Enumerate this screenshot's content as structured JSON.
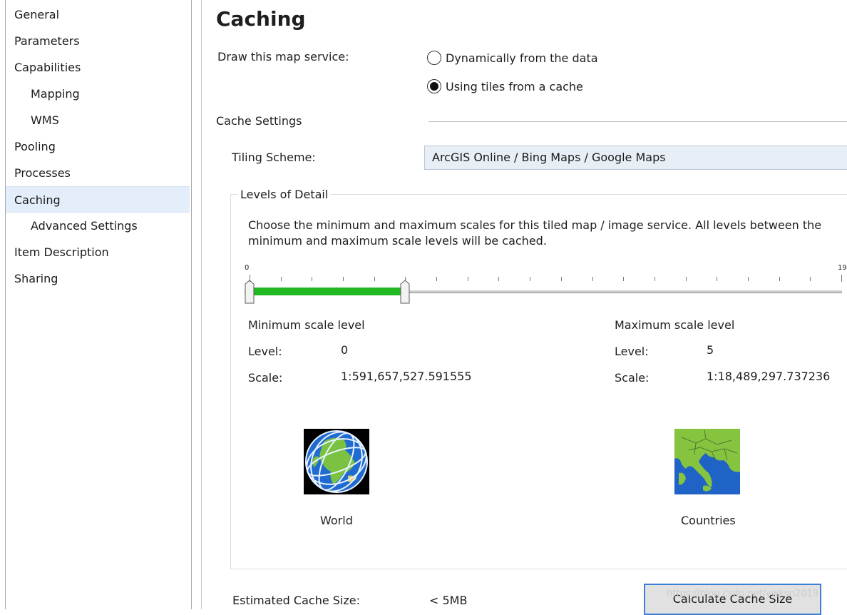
{
  "sidebar": {
    "items": [
      {
        "label": "General"
      },
      {
        "label": "Parameters"
      },
      {
        "label": "Capabilities"
      },
      {
        "label": "Mapping"
      },
      {
        "label": "WMS"
      },
      {
        "label": "Pooling"
      },
      {
        "label": "Processes"
      },
      {
        "label": "Caching"
      },
      {
        "label": "Advanced Settings"
      },
      {
        "label": "Item Description"
      },
      {
        "label": "Sharing"
      }
    ],
    "selected": "Caching"
  },
  "main": {
    "title": "Caching",
    "draw_label": "Draw this map service:",
    "draw_options": [
      {
        "label": "Dynamically from the data",
        "checked": false
      },
      {
        "label": "Using tiles from a cache",
        "checked": true
      }
    ],
    "cache_settings_label": "Cache Settings",
    "tiling_scheme_label": "Tiling Scheme:",
    "tiling_scheme_value": "ArcGIS Online / Bing Maps / Google Maps",
    "levels_of_detail": {
      "legend": "Levels of Detail",
      "description": "Choose the minimum and maximum scales for this tiled map / image service. All levels between the minimum and maximum scale levels will be cached.",
      "slider": {
        "min_label": "0",
        "max_label": "19",
        "range_min": 0,
        "range_max": 19,
        "selected_min": 0,
        "selected_max": 5,
        "fill_color": "#22b822"
      },
      "minimum": {
        "heading": "Minimum scale level",
        "level_label": "Level:",
        "level_value": "0",
        "scale_label": "Scale:",
        "scale_value": "1:591,657,527.591555",
        "thumbnail_label": "World",
        "thumbnail_icon": "globe-icon"
      },
      "maximum": {
        "heading": "Maximum scale level",
        "level_label": "Level:",
        "level_value": "5",
        "scale_label": "Scale:",
        "scale_value": "1:18,489,297.737236",
        "thumbnail_label": "Countries",
        "thumbnail_icon": "countries-map-icon"
      }
    },
    "estimated_size_label": "Estimated Cache Size:",
    "estimated_size_value": "< 5MB",
    "calculate_button": "Calculate Cache Size",
    "watermark": "https://blog.csdn.net/ywksn2019"
  }
}
